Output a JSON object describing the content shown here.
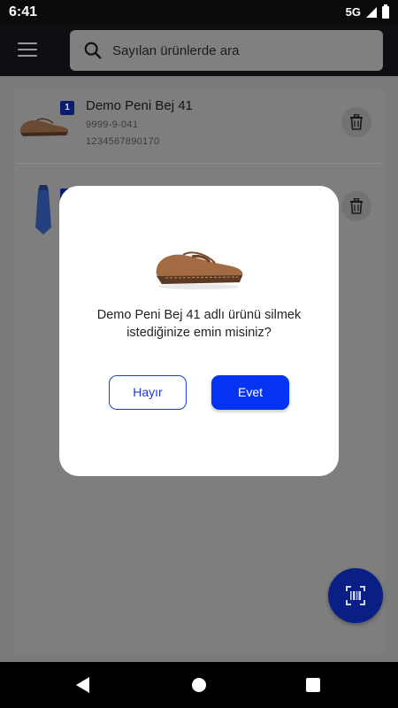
{
  "status_bar": {
    "time": "6:41",
    "network": "5G"
  },
  "search": {
    "placeholder": "Sayılan ürünlerde ara"
  },
  "items": [
    {
      "quantity": "1",
      "title": "Demo Peni Bej 41",
      "code": "9999-9-041",
      "barcode": "1234567890170",
      "thumbnail": "brown-loafer-shoe"
    },
    {
      "quantity": "1",
      "title": "",
      "code": "",
      "barcode": "",
      "thumbnail": "navy-tie"
    }
  ],
  "dialog": {
    "image": "brown-loafer-shoe",
    "message": "Demo Peni Bej 41 adlı ürünü silmek istediğinize emin misiniz?",
    "no_label": "Hayır",
    "yes_label": "Evet"
  },
  "colors": {
    "accent": "#0433f2",
    "fab": "#0a1f85",
    "badge": "#0b1b6e"
  }
}
